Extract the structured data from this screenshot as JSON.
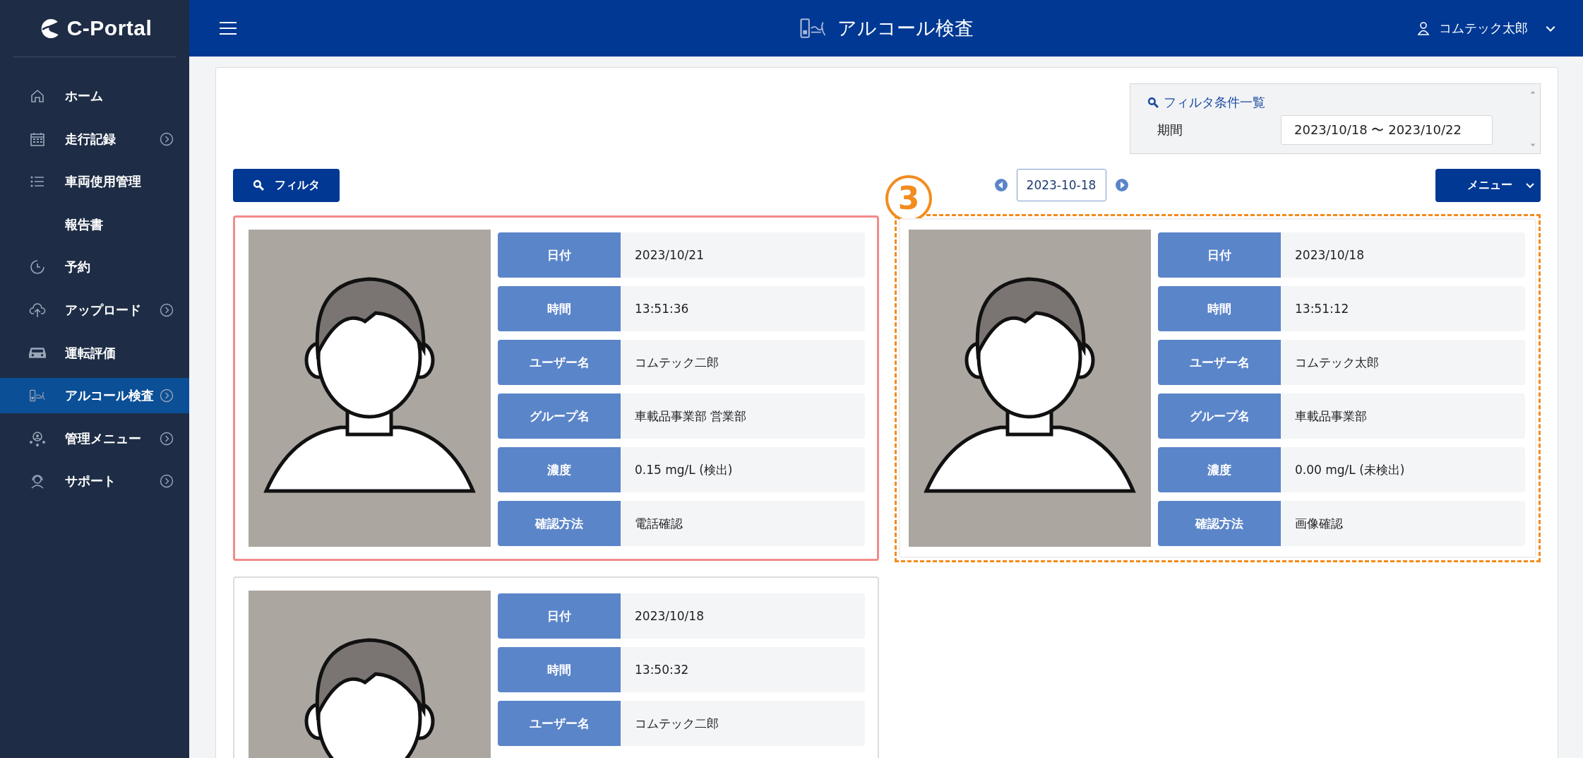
{
  "sidebar": {
    "logo": "C-Portal",
    "items": [
      {
        "label": "ホーム",
        "kind": "home",
        "expandable": false,
        "selected": false
      },
      {
        "label": "走行記録",
        "kind": "calendar",
        "expandable": true,
        "selected": false
      },
      {
        "label": "車両使用管理",
        "kind": "list",
        "expandable": false,
        "selected": false
      },
      {
        "label": "報告書",
        "kind": "none",
        "expandable": false,
        "selected": false
      },
      {
        "label": "予約",
        "kind": "clock",
        "expandable": false,
        "selected": false
      },
      {
        "label": "アップロード",
        "kind": "upload",
        "expandable": true,
        "selected": false
      },
      {
        "label": "運転評価",
        "kind": "car",
        "expandable": false,
        "selected": false
      },
      {
        "label": "アルコール検査",
        "kind": "breath",
        "expandable": true,
        "selected": true
      },
      {
        "label": "管理メニュー",
        "kind": "people",
        "expandable": true,
        "selected": false
      },
      {
        "label": "サポート",
        "kind": "support",
        "expandable": true,
        "selected": false
      }
    ]
  },
  "topbar": {
    "title": "アルコール検査",
    "user": "コムテック太郎"
  },
  "filter_summary": {
    "title": "フィルタ条件一覧",
    "conditions": [
      {
        "label": "期間",
        "value": "2023/10/18 〜 2023/10/22"
      }
    ]
  },
  "toolbar": {
    "filter_button": "フィルタ",
    "date": "2023-10-18",
    "menu_button": "メニュー"
  },
  "records": [
    {
      "selected": true,
      "fields": [
        {
          "label": "日付",
          "value": "2023/10/21"
        },
        {
          "label": "時間",
          "value": "13:51:36"
        },
        {
          "label": "ユーザー名",
          "value": "コムテック二郎"
        },
        {
          "label": "グループ名",
          "value": "車載品事業部 営業部"
        },
        {
          "label": "濃度",
          "value": "0.15 mg/L (検出)"
        },
        {
          "label": "確認方法",
          "value": "電話確認"
        }
      ]
    },
    {
      "selected": false,
      "callout": "3",
      "fields": [
        {
          "label": "日付",
          "value": "2023/10/18"
        },
        {
          "label": "時間",
          "value": "13:51:12"
        },
        {
          "label": "ユーザー名",
          "value": "コムテック太郎"
        },
        {
          "label": "グループ名",
          "value": "車載品事業部"
        },
        {
          "label": "濃度",
          "value": "0.00 mg/L (未検出)"
        },
        {
          "label": "確認方法",
          "value": "画像確認"
        }
      ]
    },
    {
      "selected": false,
      "fields": [
        {
          "label": "日付",
          "value": "2023/10/18"
        },
        {
          "label": "時間",
          "value": "13:50:32"
        },
        {
          "label": "ユーザー名",
          "value": "コムテック二郎"
        }
      ]
    }
  ]
}
